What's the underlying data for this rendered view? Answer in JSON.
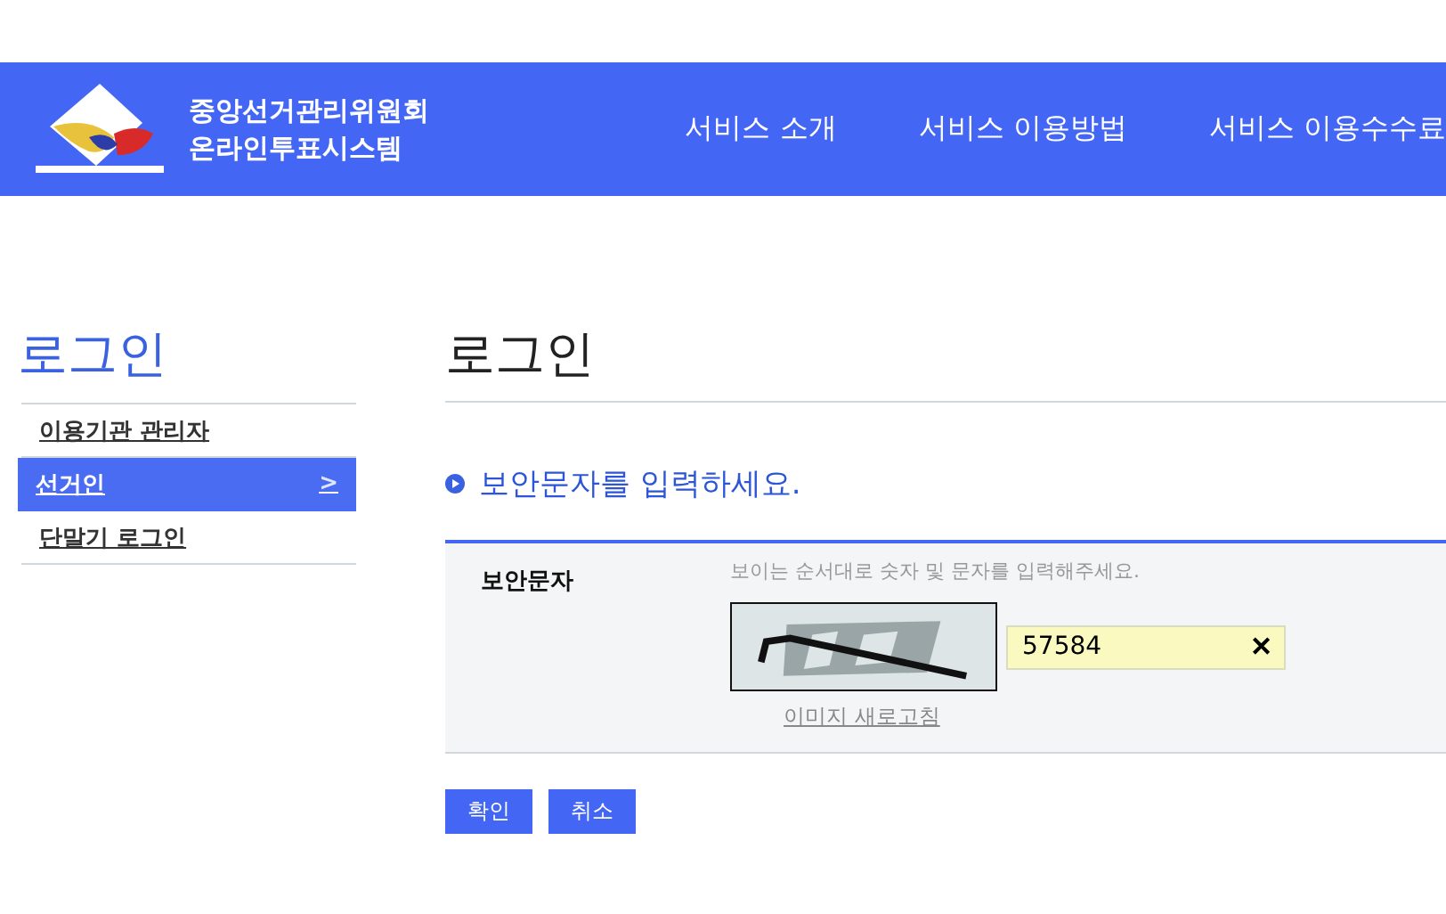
{
  "header": {
    "org_name": "중앙선거관리위원회",
    "system_name": "온라인투표시스템",
    "nav": [
      "서비스 소개",
      "서비스 이용방법",
      "서비스 이용수수료"
    ]
  },
  "sidebar": {
    "title": "로그인",
    "items": [
      {
        "label": "이용기관 관리자",
        "selected": false
      },
      {
        "label": "선거인",
        "selected": true,
        "arrow": ">"
      },
      {
        "label": "단말기 로그인",
        "selected": false
      }
    ]
  },
  "main": {
    "title": "로그인",
    "section_heading": "보안문자를 입력하세요.",
    "form": {
      "label": "보안문자",
      "hint": "보이는 순서대로 숫자 및 문자를 입력해주세요.",
      "value": "57584",
      "clear": "✕",
      "refresh_link": "이미지 새로고침"
    },
    "buttons": [
      "확인",
      "취소"
    ]
  }
}
